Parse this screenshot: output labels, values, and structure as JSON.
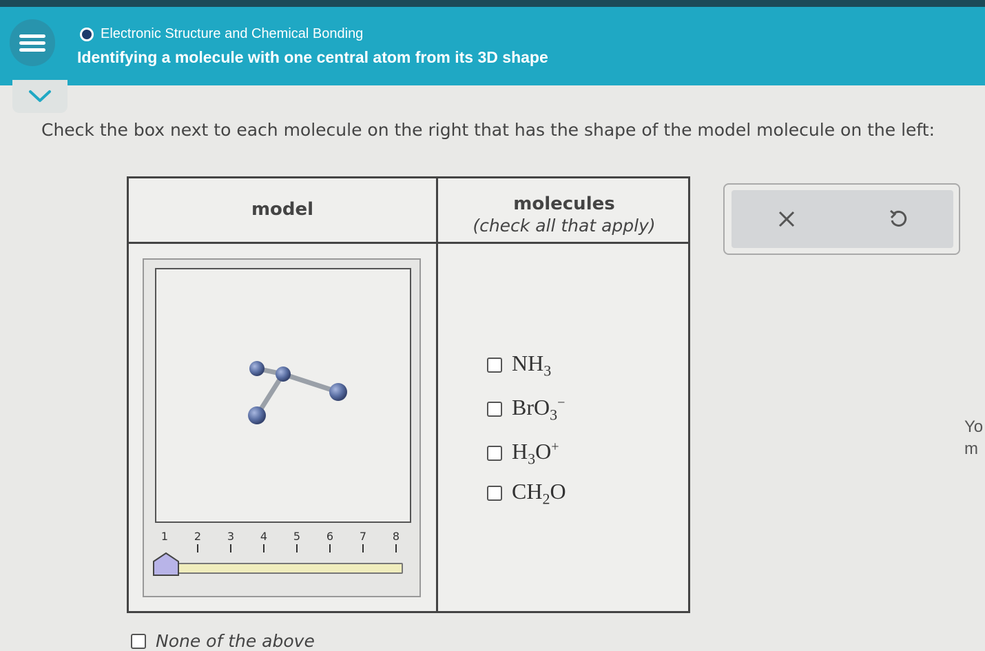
{
  "header": {
    "topic": "Electronic Structure and Chemical Bonding",
    "title": "Identifying a molecule with one central atom from its 3D shape"
  },
  "instruction": "Check the box next to each molecule on the right that has the shape of the model molecule on the left:",
  "table": {
    "model_header": "model",
    "molecules_header": "molecules",
    "molecules_subheader": "(check all that apply)"
  },
  "slider": {
    "ticks": [
      "1",
      "2",
      "3",
      "4",
      "5",
      "6",
      "7",
      "8"
    ],
    "value": 1
  },
  "molecules": [
    {
      "id": "nh3",
      "base": "NH",
      "sub": "3",
      "mid": "",
      "charge": "",
      "checked": false
    },
    {
      "id": "bro3",
      "base": "BrO",
      "sub": "3",
      "mid": "",
      "charge": "−",
      "checked": false
    },
    {
      "id": "h3o",
      "base": "H",
      "sub": "3",
      "mid": "O",
      "charge": "+",
      "checked": false
    },
    {
      "id": "ch2o",
      "base": "CH",
      "sub": "2",
      "mid": "O",
      "charge": "",
      "checked": false
    }
  ],
  "none_option": {
    "label": "None of the above",
    "checked": false
  },
  "tools": {
    "clear_icon": "x-icon",
    "undo_icon": "undo-icon"
  },
  "side_text": [
    "Yo",
    "m"
  ],
  "colors": {
    "header_bg": "#1fa8c4",
    "atom": "#5a6fa3",
    "slider_track": "#f0edbd",
    "slider_handle": "#b8b4e8"
  }
}
